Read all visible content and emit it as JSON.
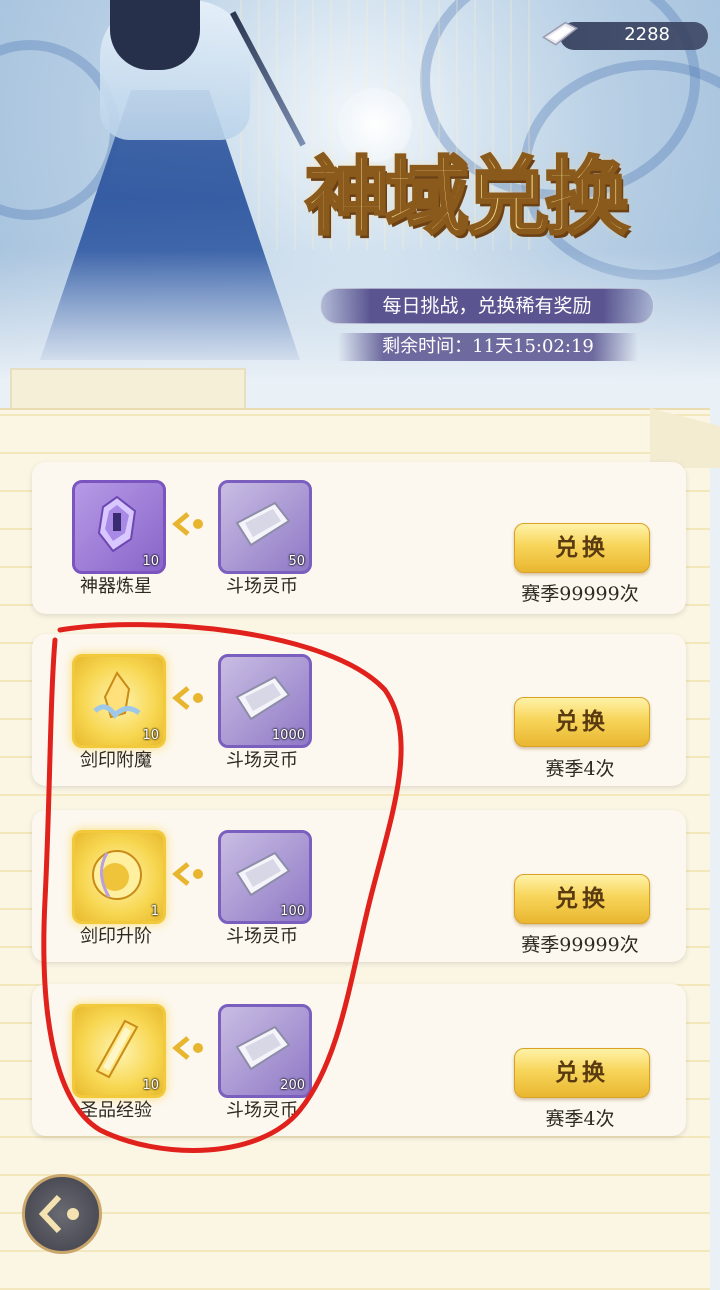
{
  "header": {
    "currency_value": "2288",
    "title": "神域兑换",
    "subtitle": "每日挑战，兑换稀有奖励",
    "countdown": "剩余时间：11天15:02:19"
  },
  "items": [
    {
      "reward_name": "神器炼星",
      "reward_qty": "10",
      "cost_name": "斗场灵币",
      "cost_qty": "50",
      "button": "兑换",
      "limit": "赛季99999次"
    },
    {
      "reward_name": "剑印附魔",
      "reward_qty": "10",
      "cost_name": "斗场灵币",
      "cost_qty": "1000",
      "button": "兑换",
      "limit": "赛季4次"
    },
    {
      "reward_name": "剑印升阶",
      "reward_qty": "1",
      "cost_name": "斗场灵币",
      "cost_qty": "100",
      "button": "兑换",
      "limit": "赛季99999次"
    },
    {
      "reward_name": "圣品经验",
      "reward_qty": "10",
      "cost_name": "斗场灵币",
      "cost_qty": "200",
      "button": "兑换",
      "limit": "赛季4次"
    }
  ],
  "colors": {
    "accent_gold": "#f7d55a",
    "rarity_purple": "#8865c9",
    "rarity_gold": "#f2c93a",
    "annotation_red": "#e0211c"
  },
  "icons": [
    "ingot-icon",
    "crystal-icon",
    "gem-icon",
    "coin-icon",
    "scroll-icon",
    "back-arrow-icon"
  ]
}
